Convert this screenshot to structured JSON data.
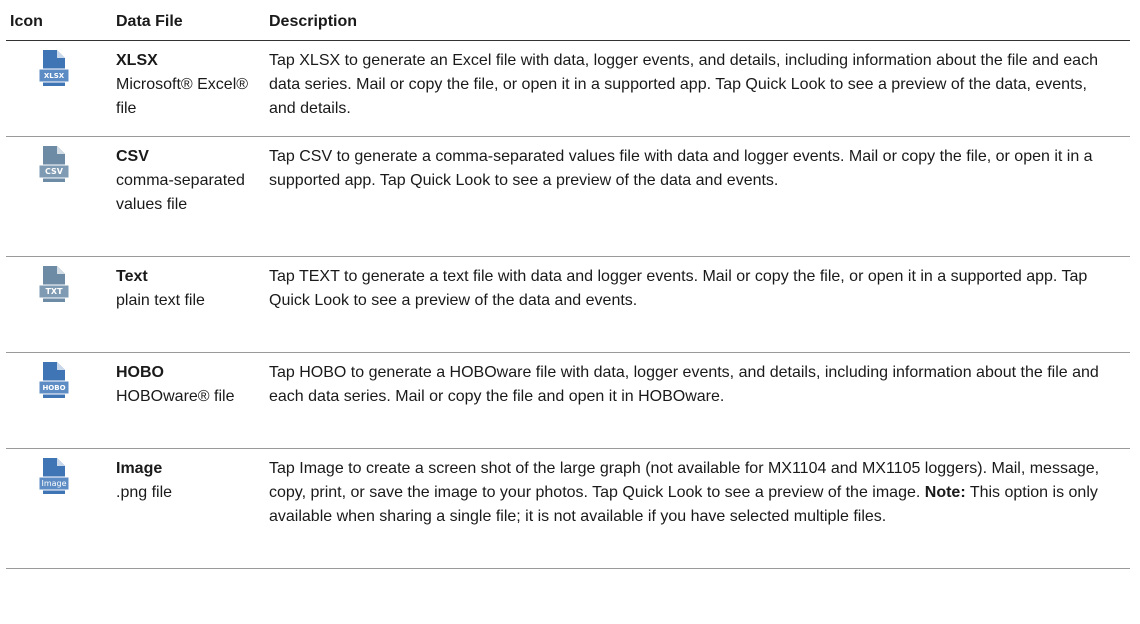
{
  "headers": {
    "icon": "Icon",
    "file": "Data File",
    "description": "Description"
  },
  "rows": [
    {
      "icon": "xlsx-file-icon",
      "icon_text": "XLSX",
      "icon_color": "#3f75b5",
      "name": "XLSX",
      "type": "Microsoft® Excel® file",
      "description": "Tap XLSX to generate an Excel file with data, logger events, and details, including information about the file and each data series. Mail or copy the file, or open it in a supported app. Tap Quick Look to see a preview of the data, events, and details."
    },
    {
      "icon": "csv-file-icon",
      "icon_text": "CSV",
      "icon_color": "#6e8ba6",
      "name": "CSV",
      "type": "comma-separated values file",
      "description": "Tap CSV to generate a comma-separated values file with data and logger events. Mail or copy the file, or open it in a supported app. Tap Quick Look to see a preview of the data and events."
    },
    {
      "icon": "txt-file-icon",
      "icon_text": "TXT",
      "icon_color": "#6e8ba6",
      "name": "Text",
      "type": "plain text file",
      "description": "Tap TEXT to generate a text file with data and logger events. Mail or copy the file, or open it in a supported app. Tap Quick Look to see a preview of the data and events."
    },
    {
      "icon": "hobo-file-icon",
      "icon_text": "HOBO",
      "icon_color": "#3f75b5",
      "name": "HOBO",
      "type": "HOBOware® file",
      "description": "Tap HOBO to generate a HOBOware file with data, logger events, and details, including information about the file and each data series. Mail or copy the file and open it in HOBOware."
    },
    {
      "icon": "image-file-icon",
      "icon_text": "Image",
      "icon_color": "#3f75b5",
      "name": "Image",
      "type": ".png file",
      "description": "Tap Image to create a screen shot of the large graph (not available for MX1104 and MX1105 loggers). Mail, message, copy, print, or save the image to your photos. Tap Quick Look to see a preview of the image. ",
      "note_label": "Note:",
      "note_text": " This option is only available when sharing a single file; it is not available if you have selected multiple files."
    }
  ]
}
